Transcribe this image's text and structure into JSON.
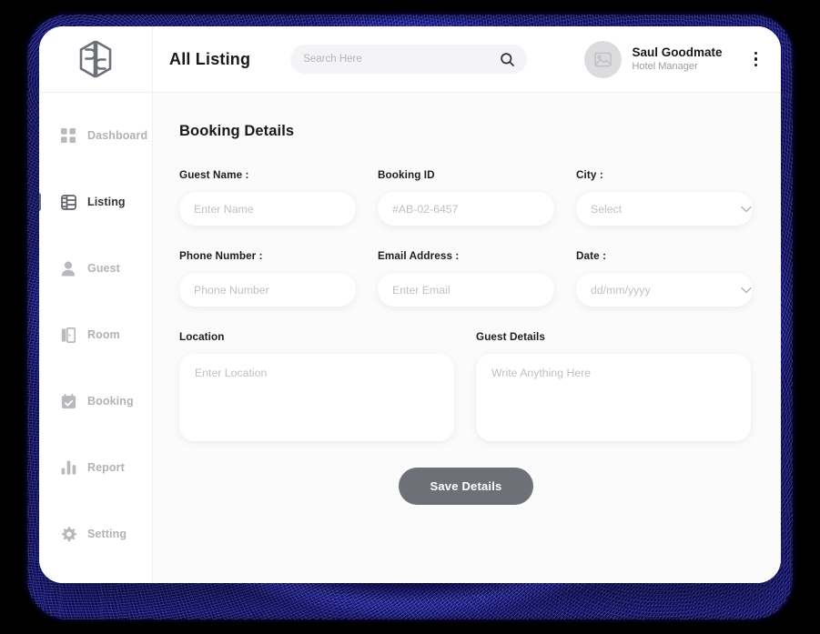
{
  "app": {
    "logo_name": "brand-hexagon-logo"
  },
  "sidebar": {
    "items": [
      {
        "label": "Dashboard",
        "icon": "grid-icon",
        "active": false
      },
      {
        "label": "Listing",
        "icon": "list-table-icon",
        "active": true
      },
      {
        "label": "Guest",
        "icon": "user-icon",
        "active": false
      },
      {
        "label": "Room",
        "icon": "door-icon",
        "active": false
      },
      {
        "label": "Booking",
        "icon": "calendar-check-icon",
        "active": false
      },
      {
        "label": "Report",
        "icon": "bar-chart-icon",
        "active": false
      },
      {
        "label": "Setting",
        "icon": "gear-icon",
        "active": false
      }
    ]
  },
  "header": {
    "title": "All Listing",
    "search": {
      "value": "",
      "placeholder": "Search Here",
      "icon": "search-icon"
    },
    "profile": {
      "name": "Saul Goodmate",
      "role": "Hotel Manager",
      "avatar_icon": "image-placeholder-icon",
      "menu_icon": "kebab-menu-icon"
    }
  },
  "main": {
    "section_title": "Booking Details",
    "fields": {
      "guest_name": {
        "label": "Guest Name :",
        "value": "",
        "placeholder": "Enter Name"
      },
      "booking_id": {
        "label": "Booking ID",
        "value": "",
        "placeholder": "#AB-02-6457"
      },
      "city": {
        "label": "City :",
        "value": "",
        "placeholder": "Select",
        "icon": "chevron-down-icon"
      },
      "phone_number": {
        "label": "Phone Number :",
        "value": "",
        "placeholder": "Phone Number"
      },
      "email_address": {
        "label": "Email Address :",
        "value": "",
        "placeholder": "Enter Email"
      },
      "date": {
        "label": "Date :",
        "value": "",
        "placeholder": "dd/mm/yyyy",
        "icon": "chevron-down-icon"
      },
      "location": {
        "label": "Location",
        "value": "",
        "placeholder": "Enter Location"
      },
      "guest_details": {
        "label": "Guest Details",
        "value": "",
        "placeholder": "Write Anything Here"
      }
    },
    "save_button": "Save Details"
  },
  "colors": {
    "page_background": "#000000",
    "glow": "#1a1abe",
    "card": "#ffffff",
    "content_background": "#fbfbfc",
    "active_nav": "#30343a",
    "muted_nav": "#b2b2b7",
    "save_button": "#6d7177",
    "placeholder": "#bfc1c6"
  }
}
